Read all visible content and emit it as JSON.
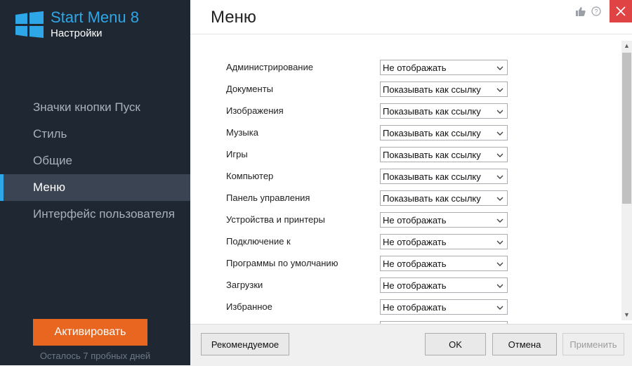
{
  "app": {
    "title": "Start Menu 8",
    "subtitle": "Настройки"
  },
  "sidebar": {
    "items": [
      {
        "label": "Значки кнопки Пуск"
      },
      {
        "label": "Стиль"
      },
      {
        "label": "Общие"
      },
      {
        "label": "Меню",
        "active": true
      },
      {
        "label": "Интерфейс пользователя"
      }
    ],
    "activate_label": "Активировать",
    "trial_text": "Осталось 7 пробных дней"
  },
  "main": {
    "title": "Меню",
    "rows": [
      {
        "label": "Администрирование",
        "value": "Не отображать"
      },
      {
        "label": "Документы",
        "value": "Показывать как ссылку"
      },
      {
        "label": "Изображения",
        "value": "Показывать как ссылку"
      },
      {
        "label": "Музыка",
        "value": "Показывать как ссылку"
      },
      {
        "label": "Игры",
        "value": "Показывать как ссылку"
      },
      {
        "label": "Компьютер",
        "value": "Показывать как ссылку"
      },
      {
        "label": "Панель управления",
        "value": "Показывать как ссылку"
      },
      {
        "label": "Устройства и принтеры",
        "value": "Не отображать"
      },
      {
        "label": "Подключение к",
        "value": "Не отображать"
      },
      {
        "label": "Программы по умолчанию",
        "value": "Не отображать"
      },
      {
        "label": "Загрузки",
        "value": "Не отображать"
      },
      {
        "label": "Избранное",
        "value": "Не отображать"
      }
    ]
  },
  "footer": {
    "recommended_label": "Рекомендуемое",
    "ok_label": "OK",
    "cancel_label": "Отмена",
    "apply_label": "Применить"
  },
  "icons": {
    "thumb": "thumbs-up-icon",
    "help": "help-icon",
    "close": "close-icon",
    "logo": "windows-logo-icon"
  },
  "colors": {
    "sidebar_bg": "#1f2733",
    "accent": "#2ea7e8",
    "activate": "#e8661f",
    "close": "#e04343"
  }
}
